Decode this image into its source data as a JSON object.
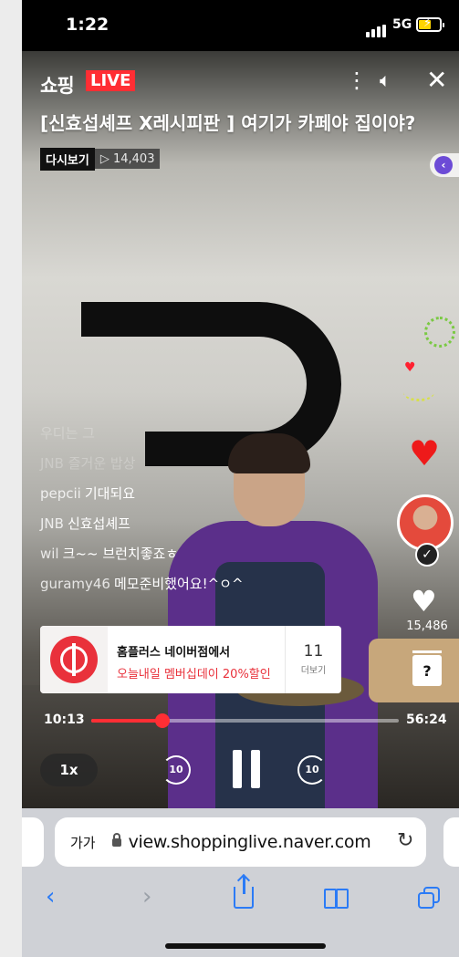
{
  "status_bar": {
    "time": "1:22",
    "network": "5G"
  },
  "header": {
    "logo": "쇼핑",
    "live_badge": "LIVE",
    "title": "[신효섭셰프 X레시피판 ] 여기가 카페야 집이야?",
    "replay_label": "다시보기",
    "view_count": "▷ 14,403",
    "more_icon": "more-vertical-icon",
    "mute_icon": "speaker-muted-icon",
    "close_icon": "close-icon"
  },
  "chat": {
    "faded_line": "우디는 그",
    "messages": [
      {
        "user": "JNB",
        "text": "즐거운 밥상",
        "faded": true
      },
      {
        "user": "pepcii",
        "text": "기대되요"
      },
      {
        "user": "JNB",
        "text": "신효섭셰프"
      },
      {
        "user": "wil",
        "text": "크~~ 브런치좋죠ㅎ"
      },
      {
        "user": "guramy46",
        "text": "메모준비했어요!^ㅇ^"
      }
    ]
  },
  "side": {
    "likes": "15,486",
    "quiz_symbol": "?"
  },
  "product": {
    "name": "홈플러스 네이버점에서",
    "promo": "오늘내일 멤버십데이 20%할인",
    "count": "11",
    "more_label": "더보기"
  },
  "player": {
    "current_time": "10:13",
    "total_time": "56:24",
    "progress": 0.232,
    "speed": "1x",
    "skip_back": "10",
    "skip_forward": "10"
  },
  "browser": {
    "text_size_label": "가가",
    "url": "view.shoppinglive.naver.com",
    "reload_icon": "reload-icon"
  },
  "colors": {
    "accent": "#ff2e34",
    "link": "#2b7bf6",
    "promo": "#e9313b"
  }
}
